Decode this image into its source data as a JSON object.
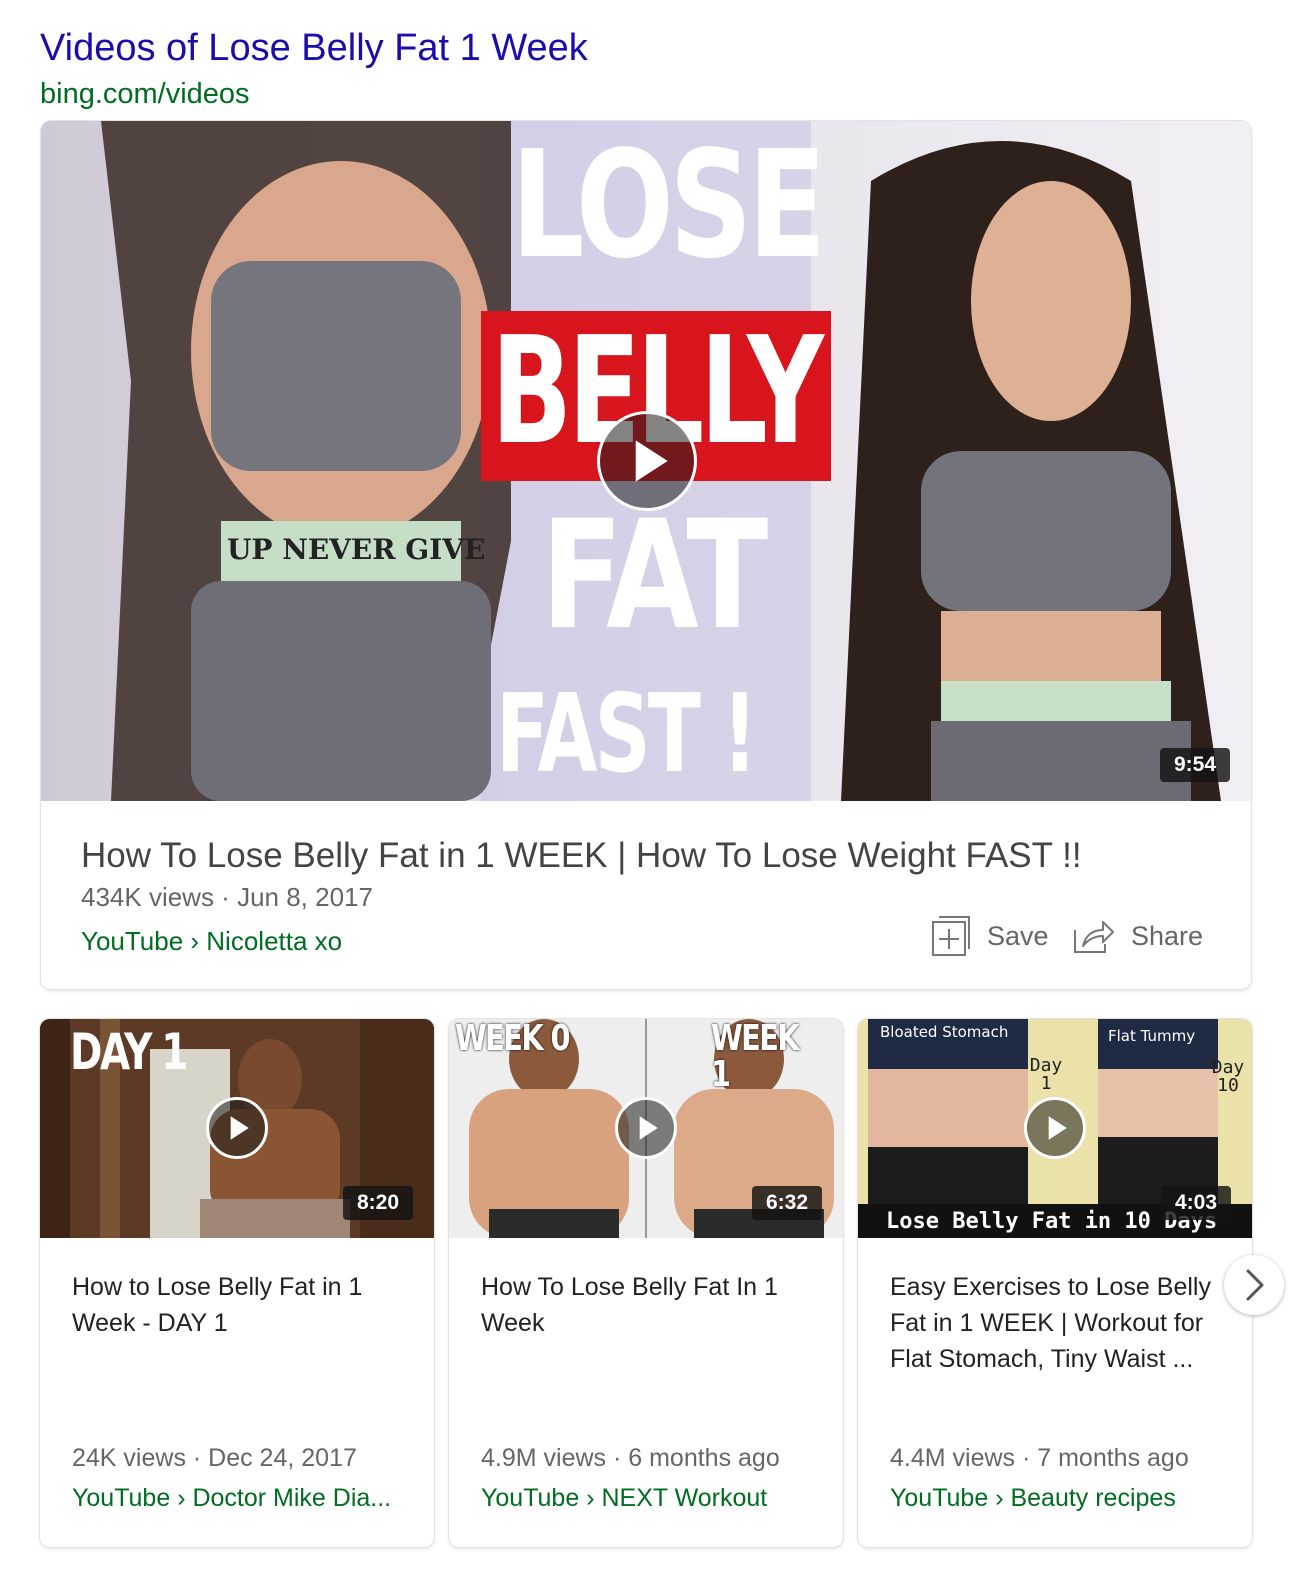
{
  "header": {
    "title": "Videos of Lose Belly Fat 1 Week",
    "url": "bing.com/videos"
  },
  "main_video": {
    "thumbnail_text": {
      "line1": "LOSE",
      "line2": "BELLY",
      "line3": "FAT",
      "line4": "FAST !",
      "waistband": "UP NEVER GIVE"
    },
    "duration": "9:54",
    "title": "How To Lose Belly Fat in 1 WEEK | How To Lose Weight FAST !!",
    "meta": "434K views · Jun 8, 2017",
    "source": "YouTube › Nicoletta xo",
    "actions": {
      "save_label": "Save",
      "save_icon": "plus-box-icon",
      "share_label": "Share",
      "share_icon": "share-arrow-icon"
    }
  },
  "videos": [
    {
      "thumbnail_text": "DAY 1",
      "duration": "8:20",
      "title": "How to Lose Belly Fat in 1 Week - DAY 1",
      "meta": "24K views · Dec 24, 2017",
      "source": "YouTube › Doctor Mike Dia..."
    },
    {
      "thumbnail_text_left": "WEEK 0",
      "thumbnail_text_right": "WEEK 1",
      "duration": "6:32",
      "title": "How To Lose Belly Fat In 1 Week",
      "meta": "4.9M views · 6 months ago",
      "source": "YouTube › NEXT Workout"
    },
    {
      "thumbnail_text_left": "Bloated Stomach",
      "thumbnail_text_right": "Flat Tummy",
      "thumbnail_day_left": "Day 1",
      "thumbnail_day_right": "Day 10",
      "thumbnail_caption": "Lose Belly Fat in 10 Days",
      "duration": "4:03",
      "title": "Easy Exercises to Lose Belly Fat in 1 WEEK | Workout for Flat Stomach, Tiny Waist ...",
      "meta": "4.4M views · 7 months ago",
      "source": "YouTube › Beauty recipes"
    }
  ],
  "carousel": {
    "next_icon": "chevron-right-icon"
  },
  "colors": {
    "title_link": "#1a0dab",
    "url_green": "#006d21",
    "thumb_red": "#d8141c"
  }
}
